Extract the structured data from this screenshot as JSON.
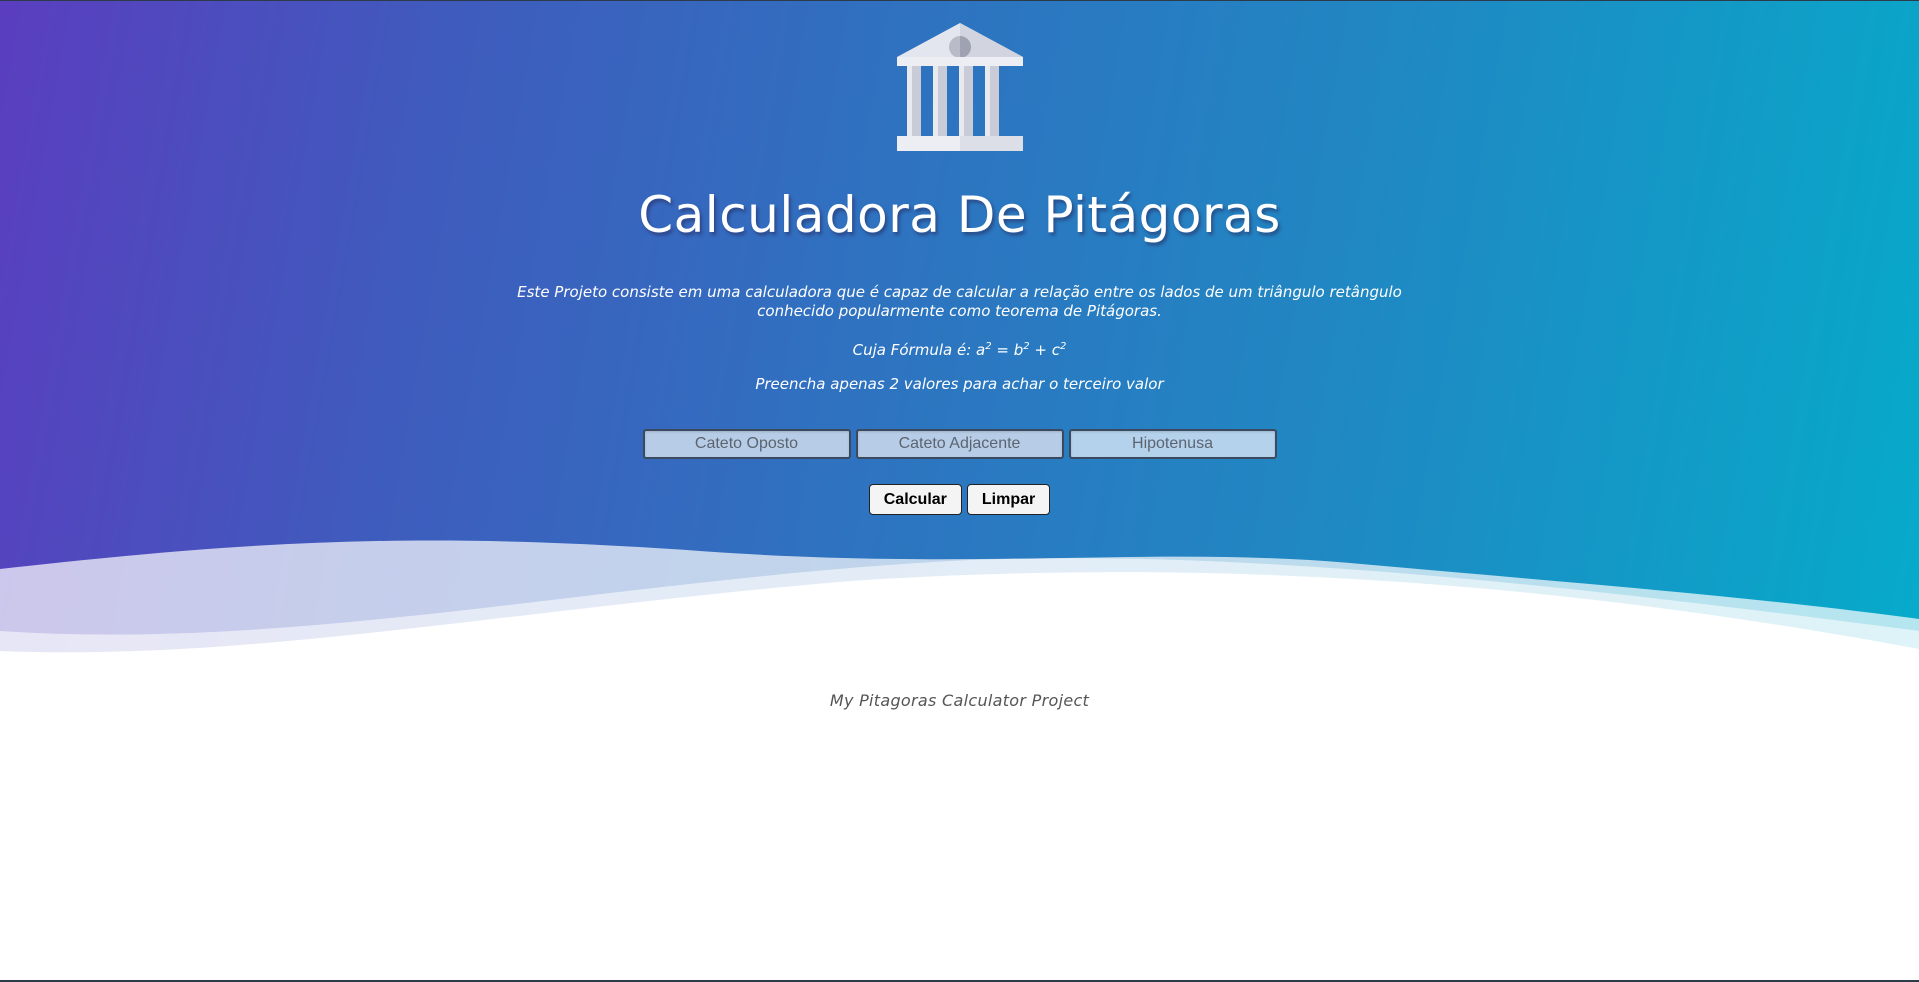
{
  "header": {
    "logo_icon": "bank-building-icon",
    "title": "Calculadora De Pitágoras"
  },
  "description": {
    "intro": "Este Projeto consiste em uma calculadora que é capaz de calcular a relação entre os lados de um triângulo retângulo conhecido popularmente como teorema de Pitágoras.",
    "formula_prefix": "Cuja Fórmula é: ",
    "formula_a": "a",
    "formula_eq": " = ",
    "formula_b": "b",
    "formula_plus": " + ",
    "formula_c": "c",
    "formula_exp": "2",
    "instruction": "Preencha apenas 2 valores para achar o terceiro valor"
  },
  "form": {
    "cateto_oposto": {
      "placeholder": "Cateto Oposto",
      "value": ""
    },
    "cateto_adjacente": {
      "placeholder": "Cateto Adjacente",
      "value": ""
    },
    "hipotenusa": {
      "placeholder": "Hipotenusa",
      "value": ""
    },
    "calcular_label": "Calcular",
    "limpar_label": "Limpar"
  },
  "footer": {
    "text": "My Pitagoras Calculator Project"
  },
  "colors": {
    "gradient_start": "#5a3ebf",
    "gradient_end": "#06abca",
    "input_bg": "#b7cce6",
    "button_bg": "#f4f4f4"
  }
}
